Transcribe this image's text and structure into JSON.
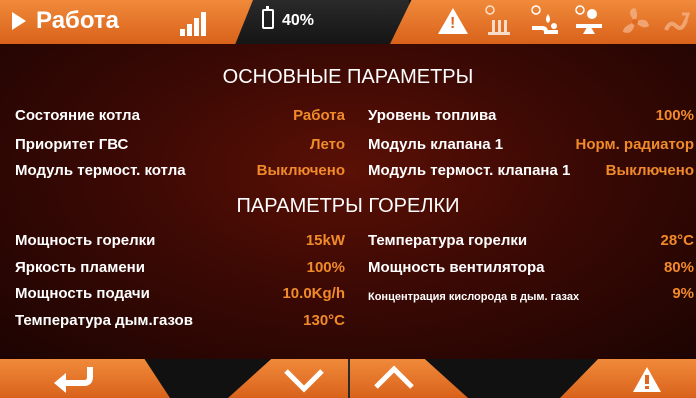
{
  "topbar": {
    "mode": "Работа",
    "fuel_level": "40%"
  },
  "status_icons": [
    "warning-icon",
    "fuel-feed-icon",
    "pump-icon",
    "valve-icon",
    "fan-icon",
    "heater-icon"
  ],
  "sections": {
    "main_title": "ОСНОВНЫЕ ПАРАМЕТРЫ",
    "burner_title": "ПАРАМЕТРЫ ГОРЕЛКИ"
  },
  "main_params": {
    "left": [
      {
        "label": "Состояние котла",
        "value": "Работа"
      },
      {
        "label": "Приоритет ГВС",
        "value": "Лето"
      },
      {
        "label": "Модуль термост. котла",
        "value": "Выключено"
      }
    ],
    "right": [
      {
        "label": "Уровень топлива",
        "value": "100%"
      },
      {
        "label": "Модуль клапана 1",
        "value": "Норм. радиатор"
      },
      {
        "label": "Модуль термост. клапана 1",
        "value": "Выключено"
      }
    ]
  },
  "burner_params": {
    "left": [
      {
        "label": "Мощность горелки",
        "value": "15kW"
      },
      {
        "label": "Яркость пламени",
        "value": "100%"
      },
      {
        "label": "Мощность подачи",
        "value": "10.0Kg/h"
      },
      {
        "label": "Температура дым.газов",
        "value": "130°C"
      }
    ],
    "right": [
      {
        "label": "Температура горелки",
        "value": "28°C"
      },
      {
        "label": "Мощность вентилятора",
        "value": "80%"
      },
      {
        "label": "Концентрация кислорода в дым. газах",
        "value": "9%"
      }
    ]
  },
  "colors": {
    "accent": "#e8732a",
    "panel_dark": "#3c0904",
    "value_text": "#f08a2a"
  }
}
